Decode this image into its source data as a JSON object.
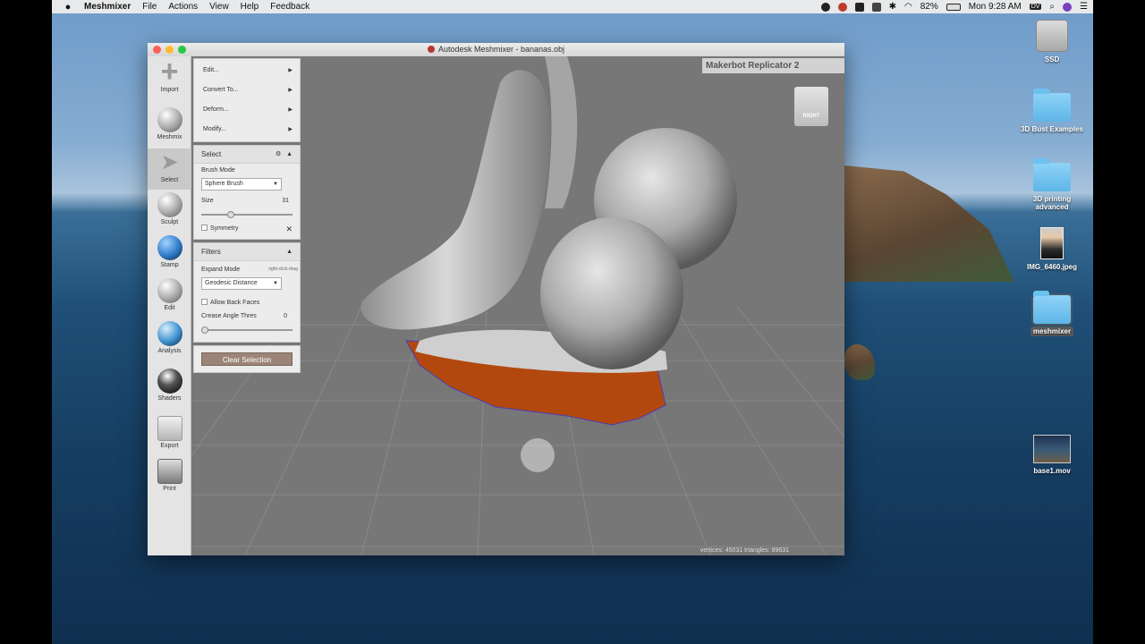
{
  "menubar": {
    "app": "Meshmixer",
    "items": [
      "File",
      "Actions",
      "View",
      "Help",
      "Feedback"
    ],
    "battery": "82%",
    "clock": "Mon 9:28 AM",
    "user_badge": "DV"
  },
  "desktop": {
    "icons": [
      {
        "label": "SSD",
        "type": "drive"
      },
      {
        "label": "3D Bust Examples",
        "type": "folder"
      },
      {
        "label": "3D printing advanced",
        "type": "folder"
      },
      {
        "label": "IMG_6460.jpeg",
        "type": "photo"
      },
      {
        "label": "meshmixer",
        "type": "folder",
        "selected": true
      },
      {
        "label": "base1.mov",
        "type": "movie"
      }
    ]
  },
  "window": {
    "title": "Autodesk Meshmixer - bananas.obj"
  },
  "toolbar": {
    "tools": [
      {
        "label": "Import"
      },
      {
        "label": "Meshmix"
      },
      {
        "label": "Select",
        "active": true
      },
      {
        "label": "Sculpt"
      },
      {
        "label": "Stamp"
      },
      {
        "label": "Edit"
      },
      {
        "label": "Analysis"
      },
      {
        "label": "Shaders"
      },
      {
        "label": "Export"
      },
      {
        "label": "Print"
      }
    ]
  },
  "panel": {
    "menus": [
      "Edit...",
      "Convert To...",
      "Deform...",
      "Modify..."
    ],
    "select": {
      "title": "Select",
      "brush_mode_label": "Brush Mode",
      "brush_mode_value": "Sphere Brush",
      "size_label": "Size",
      "size_value": "31",
      "size_fraction": 0.3,
      "symmetry_label": "Symmetry"
    },
    "filters": {
      "title": "Filters",
      "expand_mode_label": "Expand Mode",
      "expand_mode_hint": "right-click-drag",
      "expand_mode_value": "Geodesic Distance",
      "back_faces_label": "Allow Back Faces",
      "crease_label": "Crease Angle Thres",
      "crease_value": "0",
      "crease_fraction": 0.0
    },
    "clear_button": "Clear Selection"
  },
  "viewport": {
    "printer": "Makerbot Replicator 2",
    "cube_label": "RIGHT",
    "stats": "vertices: 45031 triangles: 89631"
  },
  "colors": {
    "selection": "#b2480e",
    "mesh": "#b8b8b8",
    "grid_bg": "#777777"
  }
}
